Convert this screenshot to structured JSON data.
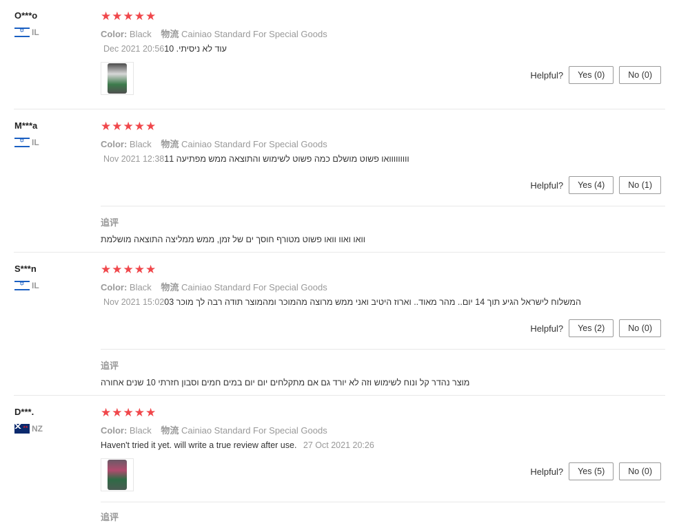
{
  "reviews": [
    {
      "user": "O***o",
      "country": "IL",
      "flag": "israel-flag-icon",
      "rating": 5,
      "color_label": "Color:",
      "color_value": "Black",
      "logistics_label": "物流",
      "logistics_value": "Cainiao Standard For Special Goods",
      "text": "עוד לא ניסיתי. 10",
      "date": "Dec 2021 20:56",
      "helpful_label": "Helpful?",
      "yes_label": "Yes (0)",
      "no_label": "No (0)"
    },
    {
      "user": "M***a",
      "country": "IL",
      "flag": "israel-flag-icon",
      "rating": 5,
      "color_label": "Color:",
      "color_value": "Black",
      "logistics_label": "物流",
      "logistics_value": "Cainiao Standard For Special Goods",
      "text": "ווווווווואו פשוט מושלם כמה פשוט לשימוש והתוצאה ממש מפתיעה 11",
      "date": "Nov 2021 12:38",
      "helpful_label": "Helpful?",
      "yes_label": "Yes (4)",
      "no_label": "No (1)",
      "followup_label": "追评",
      "followup_text": "וואו ואוו וואו פשוט מטורף חוסך ים של זמן, ממש ממליצה התוצאה מושלמת"
    },
    {
      "user": "S***n",
      "country": "IL",
      "flag": "israel-flag-icon",
      "rating": 5,
      "color_label": "Color:",
      "color_value": "Black",
      "logistics_label": "物流",
      "logistics_value": "Cainiao Standard For Special Goods",
      "text": "המשלוח לישראל הגיע תוך 14 יום.. מהר מאוד.. וארוז היטיב ואני ממש מרוצה מהמוכר ומהמוצר תודה רבה לך מוכר 03",
      "date": "Nov 2021 15:02",
      "helpful_label": "Helpful?",
      "yes_label": "Yes (2)",
      "no_label": "No (0)",
      "followup_label": "追评",
      "followup_text": "מוצר נהדר קל ונוח לשימוש וזה לא יורד גם אם מתקלחים יום יום במים חמים וסבון חזרתי 10 שנים אחורה"
    },
    {
      "user": "D***.",
      "country": "NZ",
      "flag": "new-zealand-flag-icon",
      "rating": 5,
      "color_label": "Color:",
      "color_value": "Black",
      "logistics_label": "物流",
      "logistics_value": "Cainiao Standard For Special Goods",
      "text": "Haven't tried it yet. will write a true review after use.",
      "date": "27 Oct 2021 20:26",
      "helpful_label": "Helpful?",
      "yes_label": "Yes (5)",
      "no_label": "No (0)",
      "followup_label": "追评"
    }
  ],
  "star_glyph": "★",
  "colors": {
    "star": "#f0474b",
    "muted": "#999999",
    "divider": "#e8e8e8"
  }
}
